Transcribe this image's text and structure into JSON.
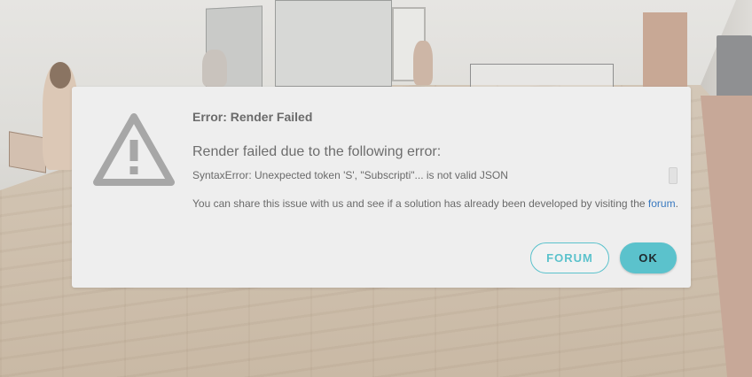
{
  "dialog": {
    "title": "Error: Render Failed",
    "heading": "Render failed due to the following error:",
    "error_message": "SyntaxError: Unexpected token 'S', \"Subscripti\"... is not valid JSON",
    "share_prefix": "You can share this issue with us and see if a solution has already been developed by visiting the ",
    "share_link": "forum",
    "share_suffix": ".",
    "icon": "warning-icon"
  },
  "buttons": {
    "forum_label": "FORUM",
    "ok_label": "OK"
  },
  "colors": {
    "accent": "#5bc2cc",
    "link": "#3a7ac0",
    "modal_bg": "#eeeeee",
    "icon": "#a7a7a7"
  }
}
